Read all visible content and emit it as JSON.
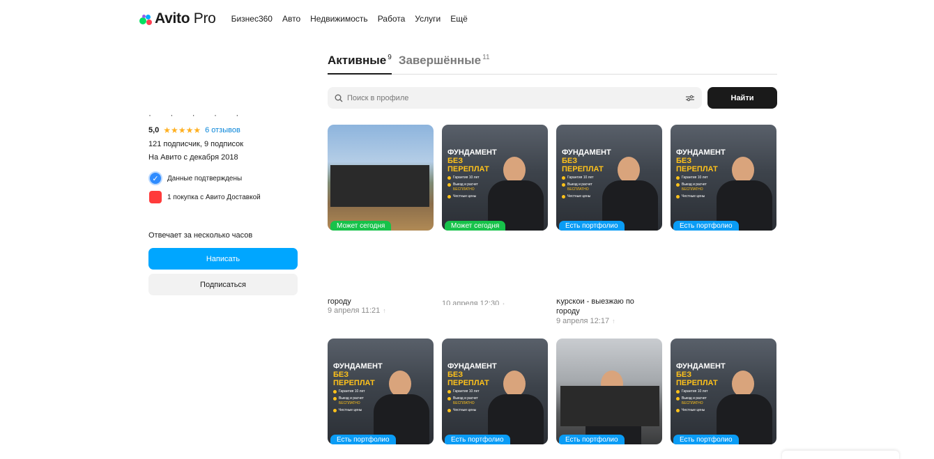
{
  "header": {
    "logo_main": "Avito",
    "logo_pro": "Pro",
    "nav": [
      "Бизнес360",
      "Авто",
      "Недвижимость",
      "Работа",
      "Услуги",
      "Ещё"
    ]
  },
  "profile": {
    "name_masked": "· · · · ·",
    "rating": "5,0",
    "stars": "★★★★★",
    "reviews": "6 отзывов",
    "followers": "121 подписчик, 9 подписок",
    "since": "На Авито с декабря 2018",
    "verified": "Данные подтверждены",
    "delivery": "1 покупка с Авито Доставкой",
    "reply_time": "Отвечает за несколько часов",
    "write_button": "Написать",
    "subscribe_button": "Подписаться"
  },
  "tabs": [
    {
      "label": "Активные",
      "count": "9"
    },
    {
      "label": "Завершённые",
      "count": "11"
    }
  ],
  "search": {
    "placeholder": "Поиск в профиле",
    "button": "Найти"
  },
  "promo": {
    "title": "ФУНДАМЕНТ",
    "subtitle": "БЕЗ ПЕРЕПЛАТ",
    "item1": "Гарантия 10 лет",
    "item2a": "Выезд и расчет",
    "item2b": "БЕСПЛАТНО",
    "item3": "Честные цены"
  },
  "cards_row1": [
    {
      "label": "Может сегодня",
      "caption": "городу",
      "date": "9 апреля 11:21"
    },
    {
      "label": "Может сегодня",
      "caption": "",
      "date": "10 апреля 12:30"
    },
    {
      "label": "Есть портфолио",
      "caption": "Курской - выезжаю по",
      "caption2": "городу",
      "date": "9 апреля 12:17"
    },
    {
      "label": "Есть портфолио",
      "caption": "",
      "date": ""
    }
  ],
  "cards_row2": [
    {
      "label": "Есть портфолио"
    },
    {
      "label": "Есть портфолио"
    },
    {
      "label": "Есть портфолио"
    },
    {
      "label": "Есть портфолио"
    }
  ],
  "colors": {
    "accent": "#00a6ff",
    "green_label": "#17c24a",
    "blue_label": "#0a9cf5",
    "star": "#ffb021"
  }
}
